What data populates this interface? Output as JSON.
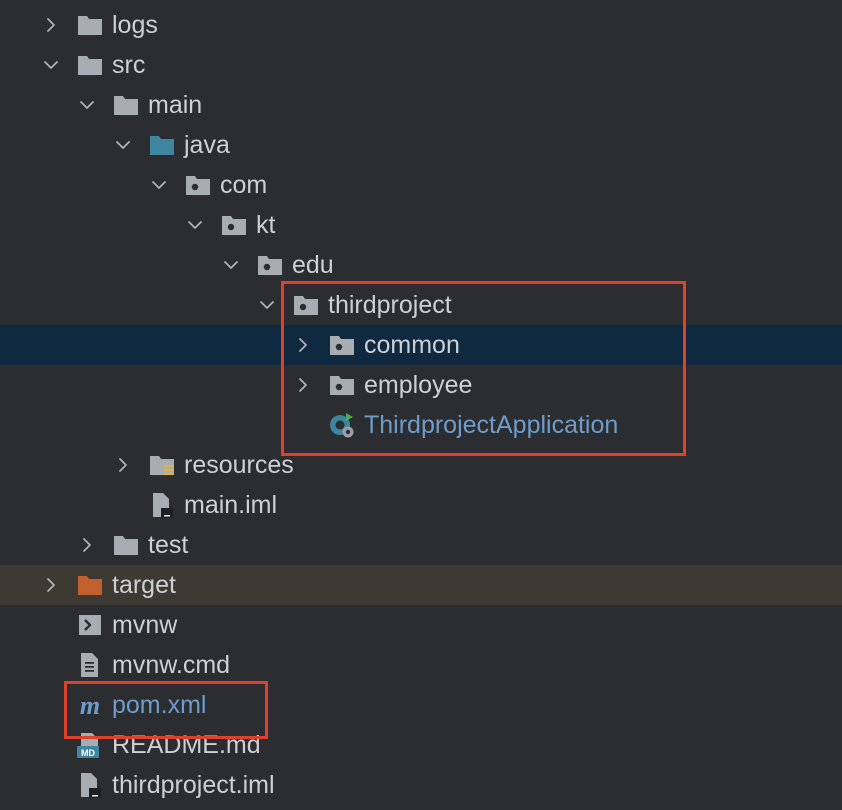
{
  "tree": {
    "items": [
      {
        "label": "logs",
        "icon": "folder-icon",
        "expanded": false,
        "depth": 0,
        "chevron": "right"
      },
      {
        "label": "src",
        "icon": "folder-icon",
        "expanded": true,
        "depth": 0,
        "chevron": "down"
      },
      {
        "label": "main",
        "icon": "folder-icon",
        "expanded": true,
        "depth": 1,
        "chevron": "down"
      },
      {
        "label": "java",
        "icon": "source-folder-icon",
        "expanded": true,
        "depth": 2,
        "chevron": "down"
      },
      {
        "label": "com",
        "icon": "package-icon",
        "expanded": true,
        "depth": 3,
        "chevron": "down"
      },
      {
        "label": "kt",
        "icon": "package-icon",
        "expanded": true,
        "depth": 4,
        "chevron": "down"
      },
      {
        "label": "edu",
        "icon": "package-icon",
        "expanded": true,
        "depth": 5,
        "chevron": "down"
      },
      {
        "label": "thirdproject",
        "icon": "package-icon",
        "expanded": true,
        "depth": 6,
        "chevron": "down"
      },
      {
        "label": "common",
        "icon": "package-icon",
        "expanded": false,
        "depth": 7,
        "chevron": "right",
        "selected": true
      },
      {
        "label": "employee",
        "icon": "package-icon",
        "expanded": false,
        "depth": 7,
        "chevron": "right"
      },
      {
        "label": "ThirdprojectApplication",
        "icon": "spring-boot-class-icon",
        "depth": 7,
        "chevron": "none",
        "link": true
      },
      {
        "label": "resources",
        "icon": "resources-folder-icon",
        "expanded": false,
        "depth": 2,
        "chevron": "right"
      },
      {
        "label": "main.iml",
        "icon": "iml-file-icon",
        "depth": 2,
        "chevron": "none"
      },
      {
        "label": "test",
        "icon": "folder-icon",
        "expanded": false,
        "depth": 1,
        "chevron": "right"
      },
      {
        "label": "target",
        "icon": "excluded-folder-icon",
        "expanded": false,
        "depth": 0,
        "chevron": "right",
        "excluded": true
      },
      {
        "label": "mvnw",
        "icon": "shell-script-icon",
        "depth": 0,
        "chevron": "none"
      },
      {
        "label": "mvnw.cmd",
        "icon": "text-file-icon",
        "depth": 0,
        "chevron": "none"
      },
      {
        "label": "pom.xml",
        "icon": "maven-icon",
        "depth": 0,
        "chevron": "none",
        "link": true
      },
      {
        "label": "README.md",
        "icon": "markdown-file-icon",
        "depth": 0,
        "chevron": "none"
      },
      {
        "label": "thirdproject.iml",
        "icon": "iml-file-icon",
        "depth": 0,
        "chevron": "none"
      }
    ]
  },
  "colors": {
    "background": "#2b2d30",
    "text": "#cdd1d6",
    "link": "#6e9dcb",
    "selected_row": "#0f2a40",
    "excluded_row": "#3d3a33",
    "highlight_box": "#e0412b",
    "folder": "#a8adb3",
    "source_folder": "#3e86a0",
    "excluded_folder": "#c2612f"
  }
}
